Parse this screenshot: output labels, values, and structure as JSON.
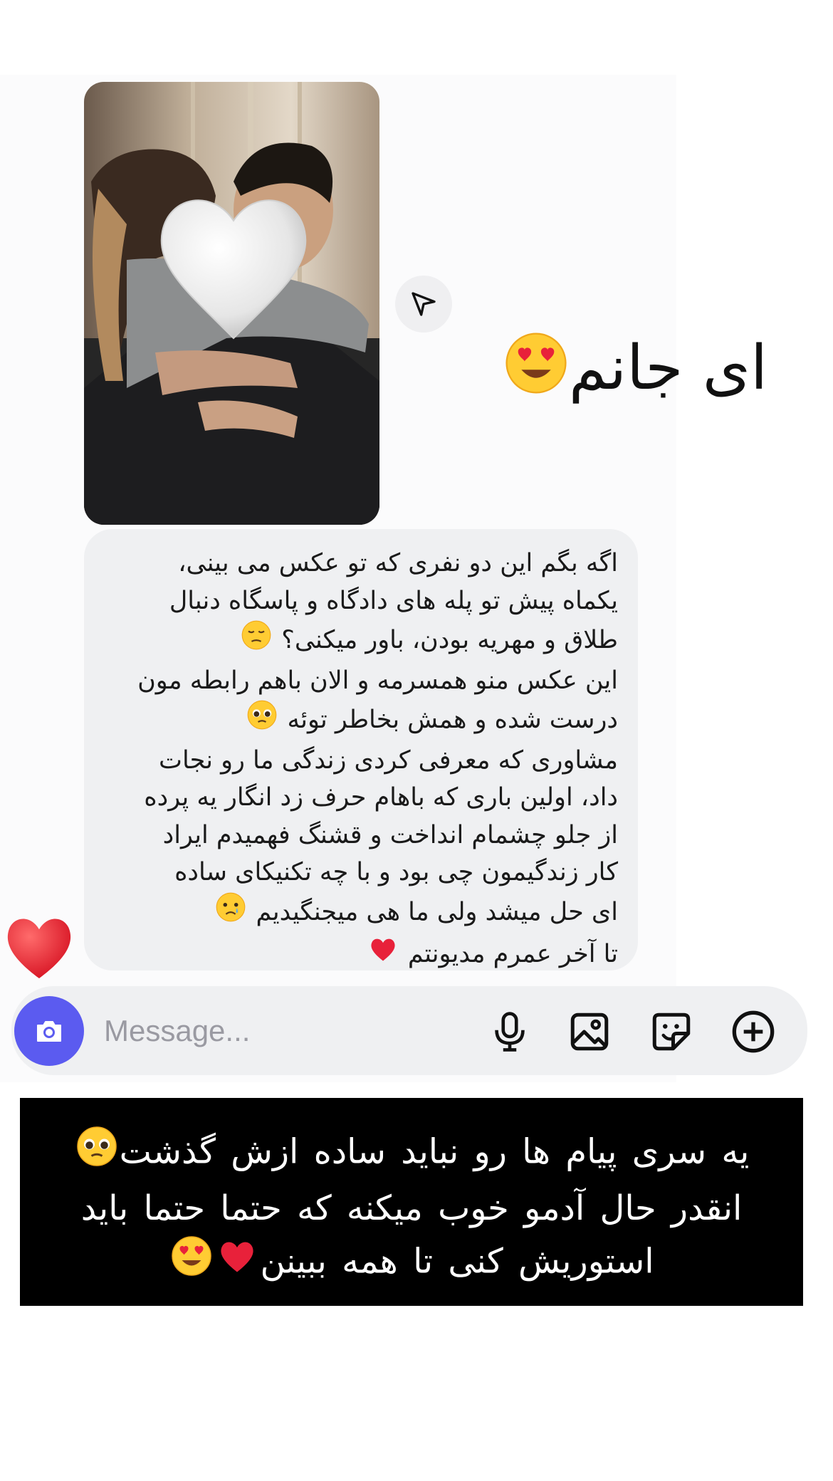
{
  "photo": {
    "alt": "couple photo with heart sticker"
  },
  "caption": {
    "text": "ای جانم",
    "emoji": "heart-eyes"
  },
  "message": {
    "lines": [
      "اگه بگم این دو نفری که تو عکس می بینی،",
      "یکماه پیش تو پله های دادگاه و پاسگاه دنبال",
      "طلاق و مهریه بودن، باور میکنی؟",
      "این عکس منو همسرمه و الان باهم رابطه مون",
      "درست شده و همش بخاطر توئه",
      "مشاوری که معرفی کردی زندگی ما رو نجات",
      "داد، اولین باری که باهام حرف زد انگار یه پرده",
      "از جلو چشمام انداخت و قشنگ فهمیدم ایراد",
      "کار زندگیمون چی بود و با چه تکنیکای ساده",
      "ای حل میشد ولی ما هی میجنگیدیم",
      "تا آخر عمرم مدیونتم"
    ],
    "line_emojis": [
      "",
      "",
      "pensive",
      "",
      "pleading",
      "",
      "",
      "",
      "",
      "crying",
      "red-heart"
    ]
  },
  "reaction": {
    "icon": "red-heart-icon"
  },
  "composer": {
    "placeholder": "Message...",
    "camera_icon": "camera-icon",
    "mic_icon": "microphone-icon",
    "gallery_icon": "image-icon",
    "sticker_icon": "sticker-icon",
    "add_icon": "plus-circle-icon",
    "accent": "#5b5bf0"
  },
  "story_note": {
    "lines": [
      "یه سری پیام ها رو نباید ساده ازش گذشت",
      "انقدر حال آدمو خوب میکنه که حتما حتما باید",
      "استوریش کنی تا همه ببینن"
    ],
    "emojis": [
      "pleading",
      "",
      "red-heart heart-eyes"
    ]
  }
}
